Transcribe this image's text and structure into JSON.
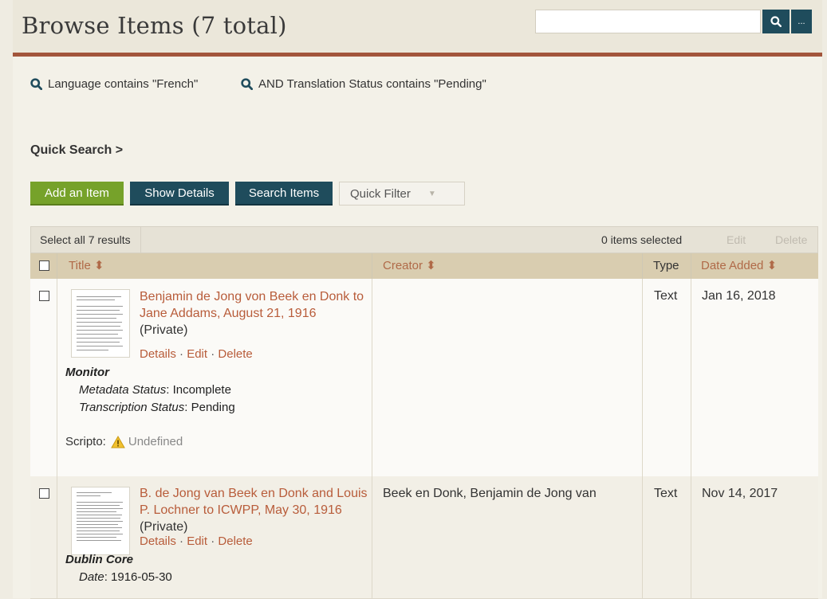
{
  "header": {
    "title": "Browse Items (7 total)",
    "search_placeholder": "",
    "more_label": "..."
  },
  "filters": [
    "Language contains \"French\"",
    "AND Translation Status contains \"Pending\""
  ],
  "quick_search": "Quick Search >",
  "toolbar": {
    "add": "Add an Item",
    "show_details": "Show Details",
    "search_items": "Search Items",
    "quick_filter": "Quick Filter"
  },
  "batch": {
    "select_all": "Select all 7 results",
    "items_selected": "0 items selected",
    "edit": "Edit",
    "delete": "Delete"
  },
  "columns": {
    "title": "Title ⬍",
    "creator": "Creator ⬍",
    "type": "Type",
    "date_added": "Date Added ⬍"
  },
  "rows": [
    {
      "title": "Benjamin de Jong von Beek en Donk to Jane Addams, August 21, 1916",
      "privacy": "(Private)",
      "actions": [
        "Details",
        "Edit",
        "Delete"
      ],
      "meta_group": "Monitor",
      "meta_lines": [
        {
          "label": "Metadata Status",
          "value": ": Incomplete"
        },
        {
          "label": "Transcription Status",
          "value": ": Pending"
        }
      ],
      "scripto_label": "Scripto:",
      "scripto_status": "Undefined",
      "creator": "",
      "type": "Text",
      "date_added": "Jan 16, 2018"
    },
    {
      "title": "B. de Jong van Beek en Donk and Louis P. Lochner to ICWPP, May 30, 1916",
      "privacy": "(Private)",
      "actions": [
        "Details",
        "Edit",
        "Delete"
      ],
      "meta_group": "Dublin Core",
      "meta_lines": [
        {
          "label": "Date",
          "value": ": 1916-05-30"
        }
      ],
      "creator": "Beek en Donk, Benjamin de Jong van",
      "type": "Text",
      "date_added": "Nov 14, 2017"
    }
  ],
  "colors": {
    "accent_rule": "#a2553b",
    "primary_button": "#1f4c5c",
    "add_button": "#76a22a",
    "link": "#b85c3a",
    "table_head": "#d9cdb0"
  }
}
